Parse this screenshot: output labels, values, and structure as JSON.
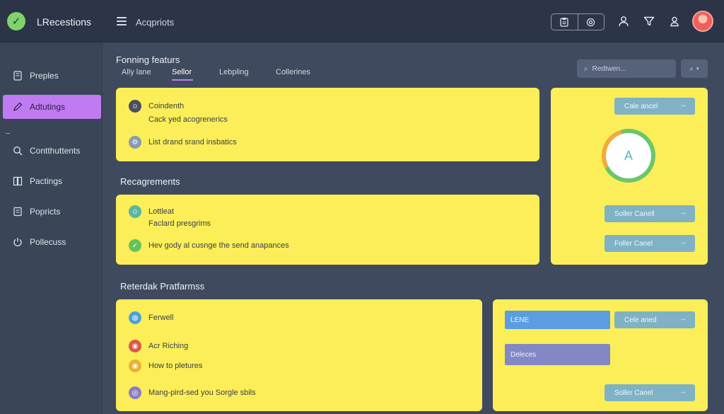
{
  "header": {
    "app_title": "LRecestions",
    "page_title": "Acqpriots",
    "tool_icons": [
      "clipboard-icon",
      "at-icon"
    ],
    "icons": [
      "user-icon",
      "filter-icon",
      "account-icon"
    ]
  },
  "sidebar": {
    "items": [
      {
        "label": "Preples",
        "icon": "device-icon"
      },
      {
        "label": "Adtutings",
        "icon": "edit-icon",
        "active": true
      },
      {
        "label": "Contthuttents",
        "icon": "search-icon"
      },
      {
        "label": "Pactings",
        "icon": "book-icon"
      },
      {
        "label": "Popricts",
        "icon": "document-icon"
      },
      {
        "label": "Pollecuss",
        "icon": "power-icon"
      }
    ]
  },
  "main": {
    "title": "Fonning featurs",
    "tabs": [
      {
        "label": "Ally lane"
      },
      {
        "label": "Sellor",
        "active": true
      },
      {
        "label": "Lebpling"
      },
      {
        "label": "Collerines"
      }
    ],
    "search": {
      "placeholder": "Redtwen..."
    }
  },
  "card1": {
    "rows": [
      {
        "text": "Coindenth",
        "icon": "person-icon"
      },
      {
        "text": "Cack yed acogrenerics",
        "icon": ""
      },
      {
        "text": "List drand srand insbatics",
        "icon": "settings-icon"
      }
    ]
  },
  "section2_title": "Recagrements",
  "card2": {
    "rows": [
      {
        "text": "Lottleat",
        "icon": "person-icon"
      },
      {
        "text": "Faclard presgrims",
        "icon": ""
      },
      {
        "text": "Hev gody al cusnge the send anapances",
        "icon": "check-icon"
      }
    ]
  },
  "section3_title": "Reterdak Pratfarmss",
  "card3": {
    "rows": [
      {
        "text": "Ferwell",
        "icon": "globe-icon"
      },
      {
        "text": "Acr Riching",
        "icon": "chrome-icon"
      },
      {
        "text": "How to pletures",
        "icon": "chrome-icon"
      },
      {
        "text": "Mang-pird-sed you Sorgle sbils",
        "icon": "compass-icon"
      }
    ]
  },
  "right_panel": {
    "btn_top": "Cale ancel",
    "avatar_letter": "A",
    "btn_mid": "Soller Canell",
    "btn_low": "Foller Canel"
  },
  "bottom_right": {
    "field1": "LENE",
    "field2": "Deleces",
    "btn_top": "Cele aned",
    "btn_bottom": "Soller Canel"
  },
  "colors": {
    "accent": "#c07af2",
    "card": "#fbee58",
    "button": "#7fb2c4",
    "field_blue": "#5a9de2",
    "field_purple": "#8288c6"
  },
  "donut": {
    "segments": [
      {
        "color": "#6cc56a",
        "fraction": 0.72
      },
      {
        "color": "#f5a93a",
        "fraction": 0.28
      }
    ]
  }
}
